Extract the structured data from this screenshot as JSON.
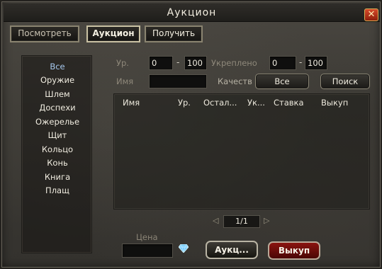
{
  "window": {
    "title": "Аукцион",
    "close_glyph": "✕"
  },
  "tabs": [
    {
      "label": "Посмотреть",
      "active": false
    },
    {
      "label": "Аукцион",
      "active": true
    },
    {
      "label": "Получить",
      "active": false
    }
  ],
  "categories": [
    "Все",
    "Оружие",
    "Шлем",
    "Доспехи",
    "Ожерелье",
    "Щит",
    "Кольцо",
    "Конь",
    "Книга",
    "Плащ"
  ],
  "selected_category": "Все",
  "filters": {
    "level_label": "Ур.",
    "level_min": "0",
    "level_max": "100",
    "enhance_label": "Укреплено",
    "enhance_min": "0",
    "enhance_max": "100",
    "name_label": "Имя",
    "name_value": "",
    "quality_label": "Качеств",
    "quality_value": "Все",
    "search_button": "Поиск",
    "dash": "-"
  },
  "table": {
    "columns": [
      "Имя",
      "Ур.",
      "Остал...",
      "Ук...",
      "Ставка",
      "Выкуп"
    ],
    "rows": []
  },
  "pagination": {
    "page": "1/1",
    "prev_glyph": "◁",
    "next_glyph": "▷"
  },
  "bottom": {
    "price_label": "Цена",
    "price_value": "",
    "currency_icon": "diamond-icon",
    "auction_button": "Аукц...",
    "buyout_button": "Выкуп"
  },
  "colors": {
    "selected_category": "#a6c8ee",
    "buyout_button": "#8a1410",
    "close_button": "#c0381c"
  }
}
